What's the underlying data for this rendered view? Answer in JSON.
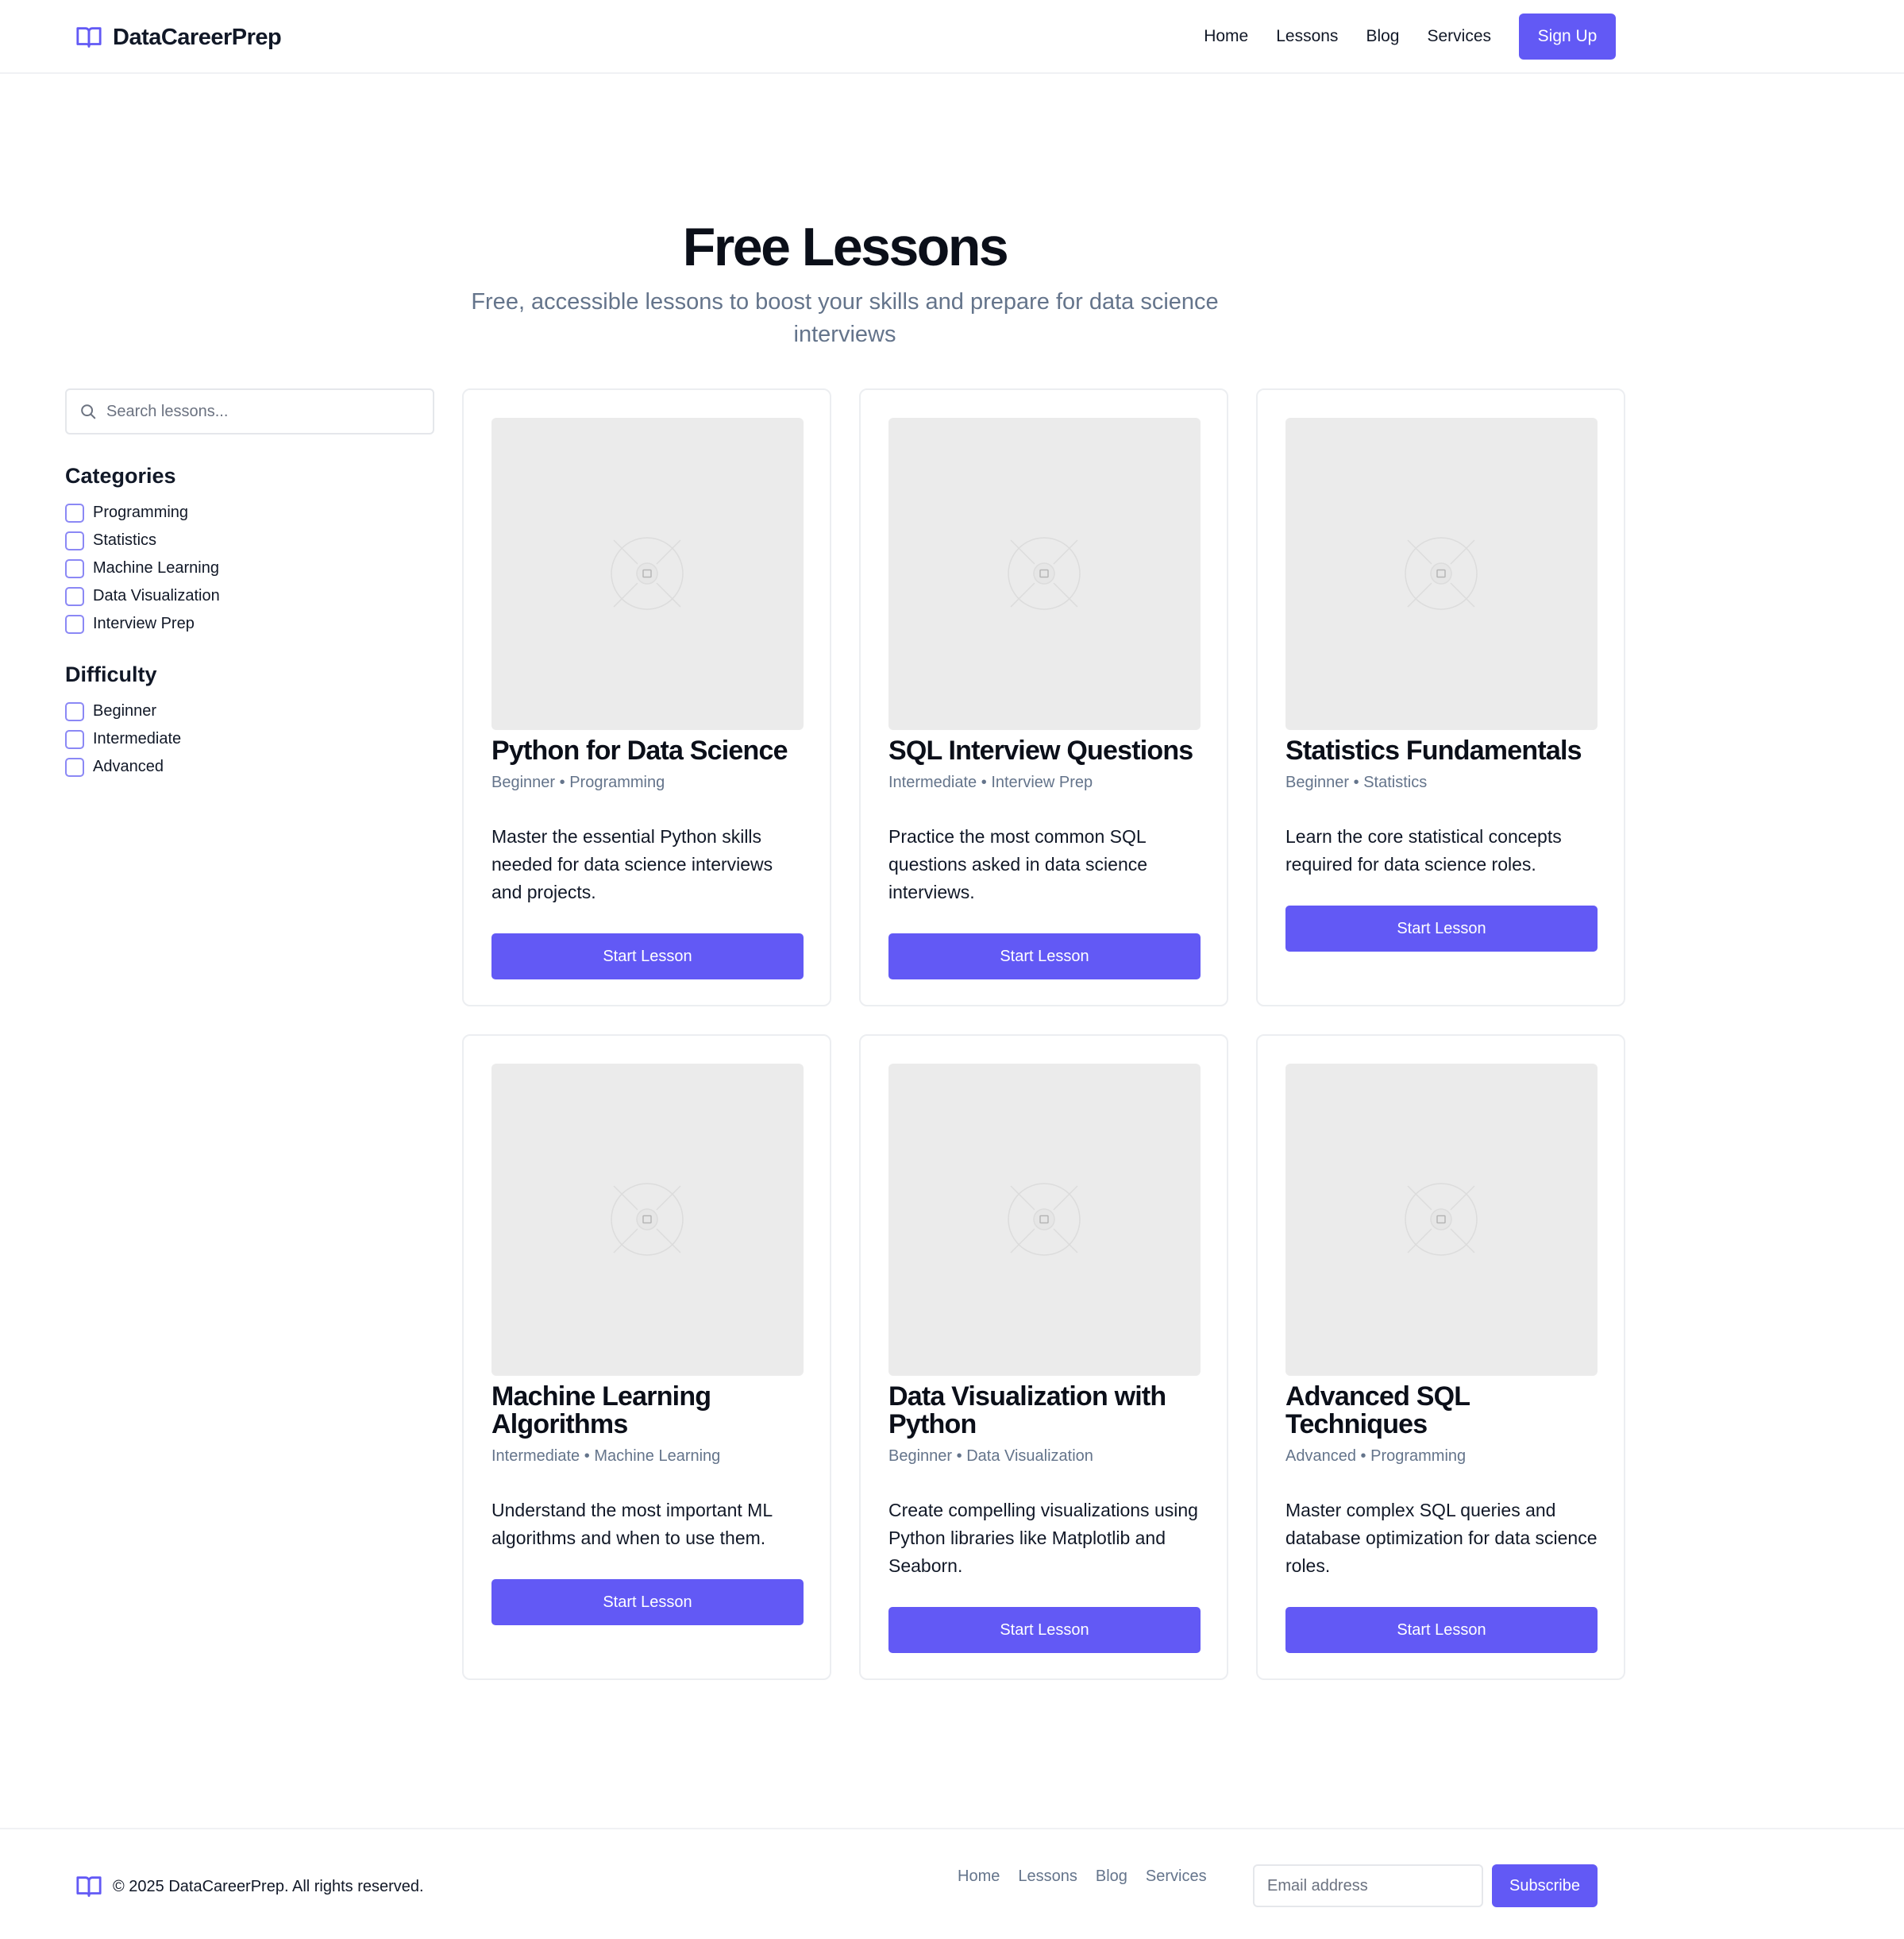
{
  "header": {
    "logo_text": "DataCareerPrep",
    "nav": [
      "Home",
      "Lessons",
      "Blog",
      "Services"
    ],
    "signup_label": "Sign Up"
  },
  "hero": {
    "title": "Free Lessons",
    "subtitle": "Free, accessible lessons to boost your skills and prepare for data science interviews"
  },
  "sidebar": {
    "search_placeholder": "Search lessons...",
    "categories_heading": "Categories",
    "categories": [
      "Programming",
      "Statistics",
      "Machine Learning",
      "Data Visualization",
      "Interview Prep"
    ],
    "difficulty_heading": "Difficulty",
    "difficulties": [
      "Beginner",
      "Intermediate",
      "Advanced"
    ]
  },
  "lessons": [
    {
      "title": "Python for Data Science",
      "level": "Beginner",
      "category": "Programming",
      "description": "Master the essential Python skills needed for data science interviews and projects.",
      "button": "Start Lesson"
    },
    {
      "title": "SQL Interview Questions",
      "level": "Intermediate",
      "category": "Interview Prep",
      "description": "Practice the most common SQL questions asked in data science interviews.",
      "button": "Start Lesson"
    },
    {
      "title": "Statistics Fundamentals",
      "level": "Beginner",
      "category": "Statistics",
      "description": "Learn the core statistical concepts required for data science roles.",
      "button": "Start Lesson"
    },
    {
      "title": "Machine Learning Algorithms",
      "level": "Intermediate",
      "category": "Machine Learning",
      "description": "Understand the most important ML algorithms and when to use them.",
      "button": "Start Lesson"
    },
    {
      "title": "Data Visualization with Python",
      "level": "Beginner",
      "category": "Data Visualization",
      "description": "Create compelling visualizations using Python libraries like Matplotlib and Seaborn.",
      "button": "Start Lesson"
    },
    {
      "title": "Advanced SQL Techniques",
      "level": "Advanced",
      "category": "Programming",
      "description": "Master complex SQL queries and database optimization for data science roles.",
      "button": "Start Lesson"
    }
  ],
  "meta_separator": "•",
  "footer": {
    "copyright": "© 2025 DataCareerPrep. All rights reserved.",
    "nav": [
      "Home",
      "Lessons",
      "Blog",
      "Services"
    ],
    "email_placeholder": "Email address",
    "subscribe_label": "Subscribe"
  },
  "colors": {
    "accent": "#6259f5",
    "muted_text": "#64748b",
    "thumb_bg": "#ebebeb"
  },
  "icons": {
    "logo": "open-book-icon",
    "search": "search-icon",
    "thumbnail": "image-placeholder-icon"
  }
}
